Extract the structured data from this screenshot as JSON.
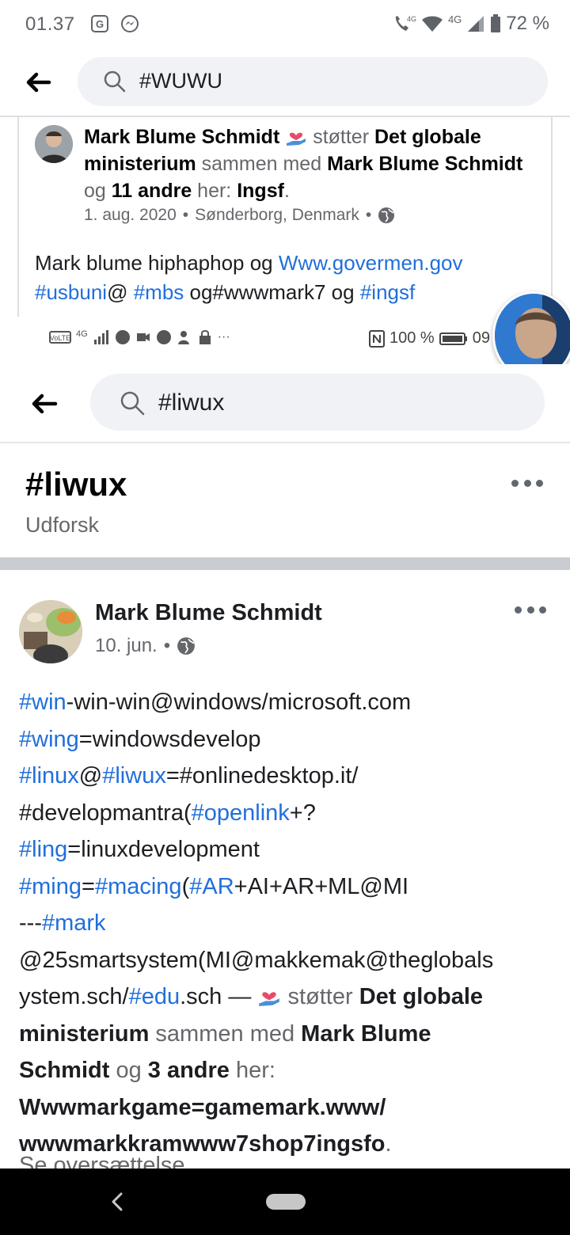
{
  "status_bar": {
    "time": "01.37",
    "network_label": "4G",
    "network_label_2": "4G",
    "battery": "72 %"
  },
  "outer_search": {
    "query": "#WUWU"
  },
  "post1": {
    "author": "Mark Blume Schmidt",
    "supports_text": "støtter",
    "cause": "Det globale ministerium",
    "with_text": "sammen med",
    "with_name": "Mark Blume Schmidt",
    "and_text": "og",
    "others": "11 andre",
    "here_text": "her:",
    "place": "Ingsf",
    "period": ".",
    "date": "1. aug. 2020",
    "location": "Sønderborg, Denmark",
    "sep": "•",
    "body_text_1": "Mark blume hiphaphop og ",
    "body_link_1": "Www.govermen.gov",
    "body_tag_1": "#usbuni",
    "body_text_2": "@ ",
    "body_tag_2": "#mbs",
    "body_text_3": " og#wwwmark7 og ",
    "body_tag_3": "#ingsf"
  },
  "inner_status_bar": {
    "network": "4G",
    "more": "···",
    "battery": "100 %",
    "time_fragment": "09"
  },
  "inner_search": {
    "query": "#liwux"
  },
  "hashtag_page": {
    "title": "#liwux",
    "subtitle": "Udforsk"
  },
  "post2": {
    "author": "Mark Blume Schmidt",
    "date": "10. jun.",
    "sep": "•",
    "lines": [
      [
        {
          "t": "#win",
          "c": "tag"
        },
        {
          "t": "-win-win@windows/microsoft.com",
          "c": ""
        }
      ],
      [
        {
          "t": "#wing",
          "c": "tag"
        },
        {
          "t": "=windowsdevelop",
          "c": ""
        }
      ],
      [
        {
          "t": "#linux",
          "c": "tag"
        },
        {
          "t": "@",
          "c": ""
        },
        {
          "t": "#liwux",
          "c": "tag"
        },
        {
          "t": "=#onlinedesktop.it/",
          "c": ""
        }
      ],
      [
        {
          "t": "#developmantra(",
          "c": ""
        },
        {
          "t": "#openlink",
          "c": "tag"
        },
        {
          "t": "+?",
          "c": ""
        }
      ],
      [
        {
          "t": "#ling",
          "c": "tag"
        },
        {
          "t": "=linuxdevelopment",
          "c": ""
        }
      ],
      [
        {
          "t": "#ming",
          "c": "tag"
        },
        {
          "t": "=",
          "c": ""
        },
        {
          "t": "#macing",
          "c": "tag"
        },
        {
          "t": "(",
          "c": ""
        },
        {
          "t": "#AR",
          "c": "tag"
        },
        {
          "t": "+AI+AR+ML@MI",
          "c": ""
        }
      ],
      [
        {
          "t": "---",
          "c": ""
        },
        {
          "t": "#mark",
          "c": "tag"
        }
      ],
      [
        {
          "t": "@25smartsystem(MI@makkemak@theglobals",
          "c": ""
        }
      ],
      [
        {
          "t": "ystem.sch/",
          "c": ""
        },
        {
          "t": "#edu",
          "c": "tag"
        },
        {
          "t": ".sch — ",
          "c": ""
        },
        {
          "t": "HEART",
          "c": "heart"
        },
        {
          "t": " støtter ",
          "c": "muted"
        },
        {
          "t": "Det globale",
          "c": "bold"
        }
      ],
      [
        {
          "t": "ministerium",
          "c": "bold"
        },
        {
          "t": " sammen med ",
          "c": "muted"
        },
        {
          "t": "Mark Blume",
          "c": "bold"
        }
      ],
      [
        {
          "t": "Schmidt",
          "c": "bold"
        },
        {
          "t": " og ",
          "c": "muted"
        },
        {
          "t": "3 andre",
          "c": "bold"
        },
        {
          "t": " her:",
          "c": "muted"
        }
      ],
      [
        {
          "t": "Wwwmarkgame=gamemark.www/",
          "c": "bold"
        }
      ],
      [
        {
          "t": "wwwmarkkramwww7shop7ingsfo",
          "c": "bold"
        },
        {
          "t": ".",
          "c": "muted"
        }
      ]
    ],
    "see_translation": "Se oversættelse"
  },
  "colors": {
    "link": "#216fdb",
    "muted": "#65676b",
    "divider": "#c9ccd1",
    "search_bg": "#f0f2f5"
  }
}
